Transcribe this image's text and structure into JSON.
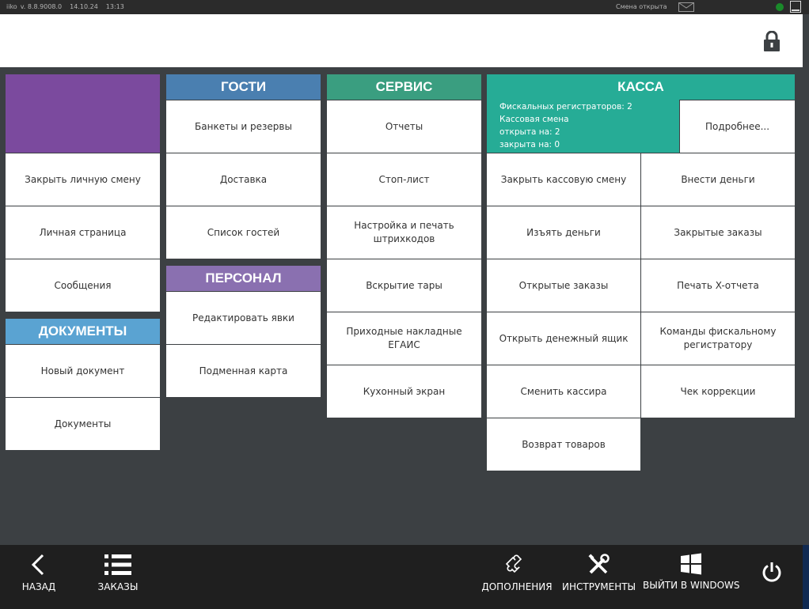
{
  "status": {
    "app": "iiko",
    "version": "v. 8.8.9008.0",
    "date": "14.10.24",
    "time": "13:13",
    "shift": "Смена открыта"
  },
  "icons": {
    "lock": "lock-icon",
    "back": "chevron-left-icon",
    "orders": "list-icon",
    "addons": "puzzle-icon",
    "tools": "tools-icon",
    "windows": "windows-icon",
    "power": "power-icon",
    "mail": "mail-icon"
  },
  "colors": {
    "background": "#3c4043",
    "guests": "#4a7fb0",
    "service": "#3a9e80",
    "kassa": "#26ac96",
    "personnel": "#8a70b0",
    "documents": "#5aa3d2",
    "user_tile": "#7b4a9e"
  },
  "user": {
    "close_shift": "Закрыть личную смену",
    "personal_page": "Личная страница",
    "messages": "Сообщения"
  },
  "documents": {
    "title": "ДОКУМЕНТЫ",
    "new_document": "Новый документ",
    "documents": "Документы"
  },
  "guests": {
    "title": "ГОСТИ",
    "banquets": "Банкеты и резервы",
    "delivery": "Доставка",
    "guest_list": "Список гостей"
  },
  "personnel": {
    "title": "ПЕРСОНАЛ",
    "edit_attendance": "Редактировать явки",
    "substitute_card": "Подменная карта"
  },
  "service": {
    "title": "СЕРВИС",
    "reports": "Отчеты",
    "stop_list": "Стоп-лист",
    "barcodes_line1": "Настройка и печать",
    "barcodes_line2": "штрихкодов",
    "open_container": "Вскрытие тары",
    "egais_line1": "Приходные накладные",
    "egais_line2": "ЕГАИС",
    "kitchen_screen": "Кухонный экран"
  },
  "kassa": {
    "title": "КАССА",
    "info_line1": "Фискальных регистраторов: 2",
    "info_line2": "Кассовая смена",
    "info_line3": "открыта на: 2",
    "info_line4": "закрыта на: 0",
    "details": "Подробнее...",
    "close_cash_shift": "Закрыть кассовую смену",
    "deposit_money": "Внести деньги",
    "withdraw_money": "Изъять деньги",
    "closed_orders": "Закрытые заказы",
    "open_orders": "Открытые заказы",
    "print_x_report": "Печать X-отчета",
    "open_cash_drawer": "Открыть денежный ящик",
    "fiscal_cmd_line1": "Команды фискальному",
    "fiscal_cmd_line2": "регистратору",
    "change_cashier": "Сменить кассира",
    "correction_check": "Чек коррекции",
    "return_goods": "Возврат товаров"
  },
  "nav": {
    "back": "НАЗАД",
    "orders": "ЗАКАЗЫ",
    "addons": "ДОПОЛНЕНИЯ",
    "tools": "ИНСТРУМЕНТЫ",
    "exit_windows": "ВЫЙТИ В WINDOWS"
  }
}
